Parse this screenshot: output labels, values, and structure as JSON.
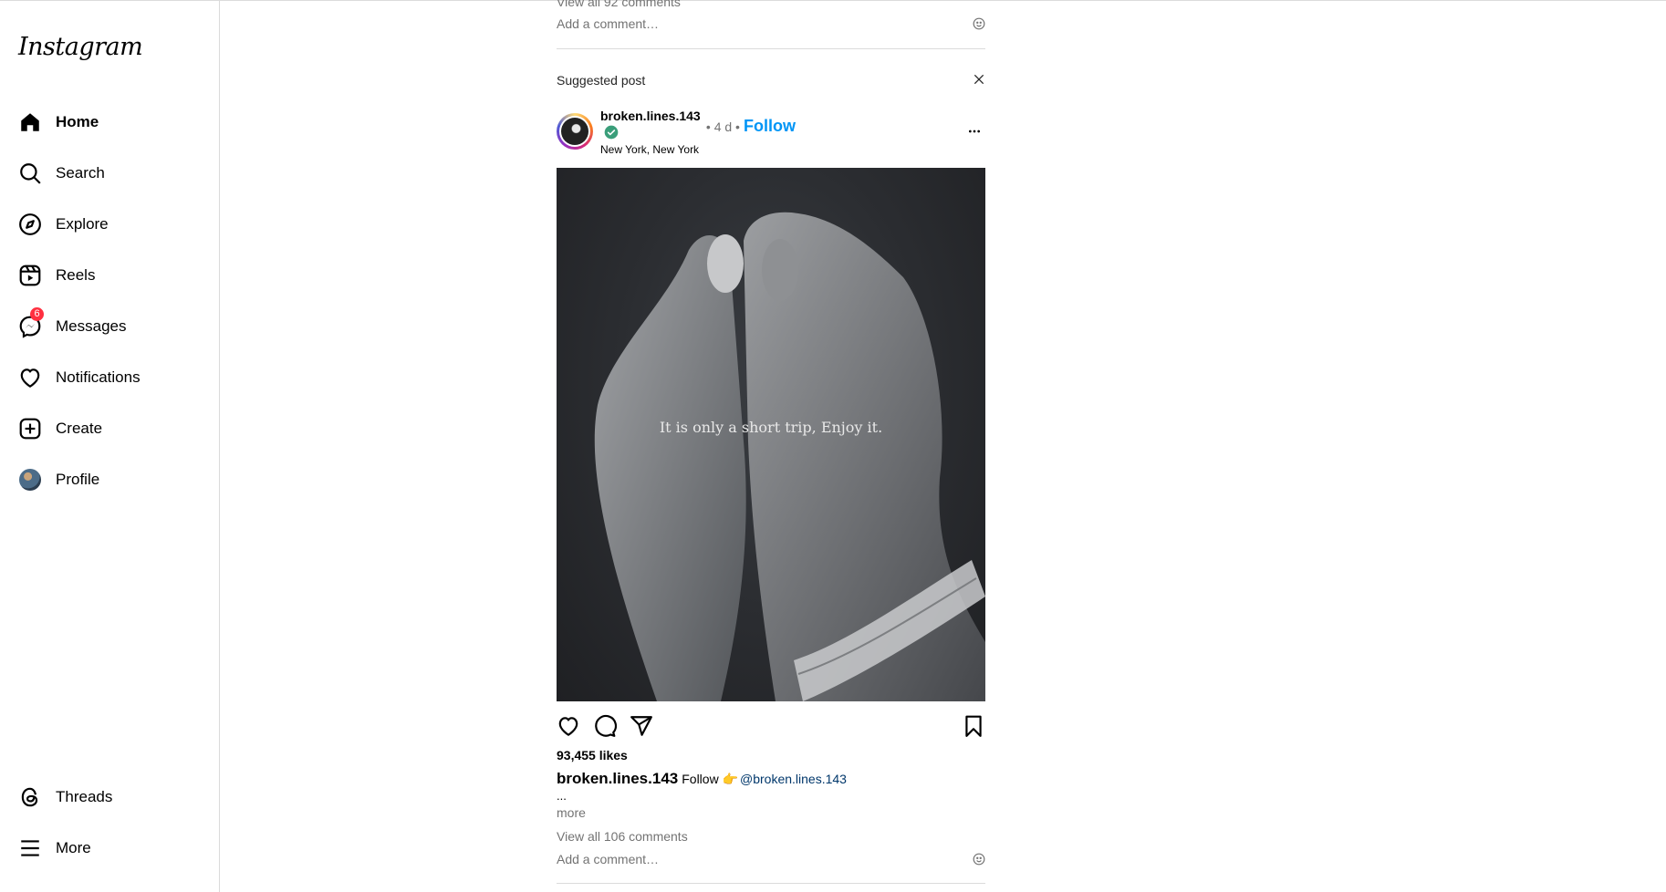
{
  "sidebar": {
    "logo": "Instagram",
    "items": [
      {
        "label": "Home",
        "icon": "home-icon"
      },
      {
        "label": "Search",
        "icon": "search-icon"
      },
      {
        "label": "Explore",
        "icon": "compass-icon"
      },
      {
        "label": "Reels",
        "icon": "reels-icon"
      },
      {
        "label": "Messages",
        "icon": "messenger-icon",
        "badge": "6"
      },
      {
        "label": "Notifications",
        "icon": "heart-icon"
      },
      {
        "label": "Create",
        "icon": "plus-square-icon"
      },
      {
        "label": "Profile",
        "icon": "avatar"
      }
    ],
    "bottom_items": [
      {
        "label": "Threads",
        "icon": "threads-icon"
      },
      {
        "label": "More",
        "icon": "menu-icon"
      }
    ]
  },
  "previous_post": {
    "view_comments": "View all 92 comments",
    "add_comment_placeholder": "Add a comment…"
  },
  "post": {
    "suggested_label": "Suggested post",
    "username": "broken.lines.143",
    "time": "4 d",
    "follow_label": "Follow",
    "location": "New York, New York",
    "image_text": "It is only a short trip, Enjoy it.",
    "likes": "93,455 likes",
    "caption_user": "broken.lines.143",
    "caption_text": "Follow 👉",
    "caption_mention": "@broken.lines.143",
    "ellipsis": "...",
    "more_label": "more",
    "view_comments": "View all 106 comments",
    "add_comment_placeholder": "Add a comment…"
  },
  "colors": {
    "accent": "#0095f6",
    "badge": "#ff3040",
    "muted": "#737373",
    "border": "#dbdbdb",
    "mention": "#00376b"
  }
}
